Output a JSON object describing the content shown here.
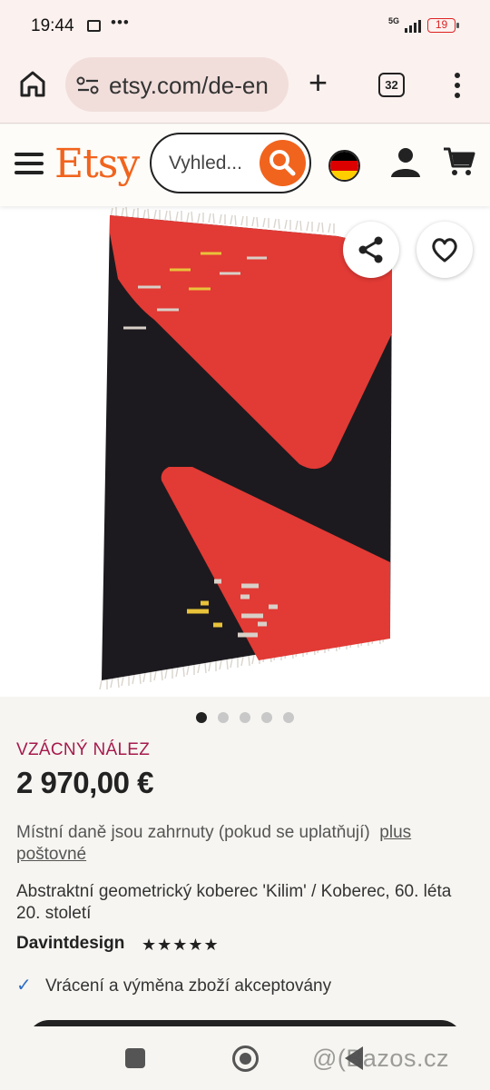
{
  "status_bar": {
    "time": "19:44",
    "more": "•••",
    "network": "5G",
    "battery": "19"
  },
  "browser": {
    "url": "etsy.com/de-en",
    "tab_count": "32"
  },
  "header": {
    "logo": "Etsy",
    "search_placeholder": "Vyhled...",
    "flag_colors": [
      "#000000",
      "#dd0000",
      "#ffce00"
    ]
  },
  "gallery": {
    "image_count": 5,
    "active_index": 0
  },
  "listing": {
    "badge": "VZÁCNÝ NÁLEZ",
    "price": "2 970,00 €",
    "tax_note": "Místní daně jsou zahrnuty (pokud se uplatňují)",
    "tax_link": "plus poštovné",
    "title": "Abstraktní geometrický koberec 'Kilim' / Koberec, 60. léta 20. století",
    "shop_name": "Davintdesign",
    "rating_stars": "★★★★★",
    "returns": "Vrácení a výměna zboží akceptovány"
  },
  "watermark": "@(Bazos.cz",
  "colors": {
    "accent": "#f1641e",
    "badge": "#a61a4d",
    "rug_red": "#e23a35",
    "rug_black": "#1c1a1e"
  }
}
